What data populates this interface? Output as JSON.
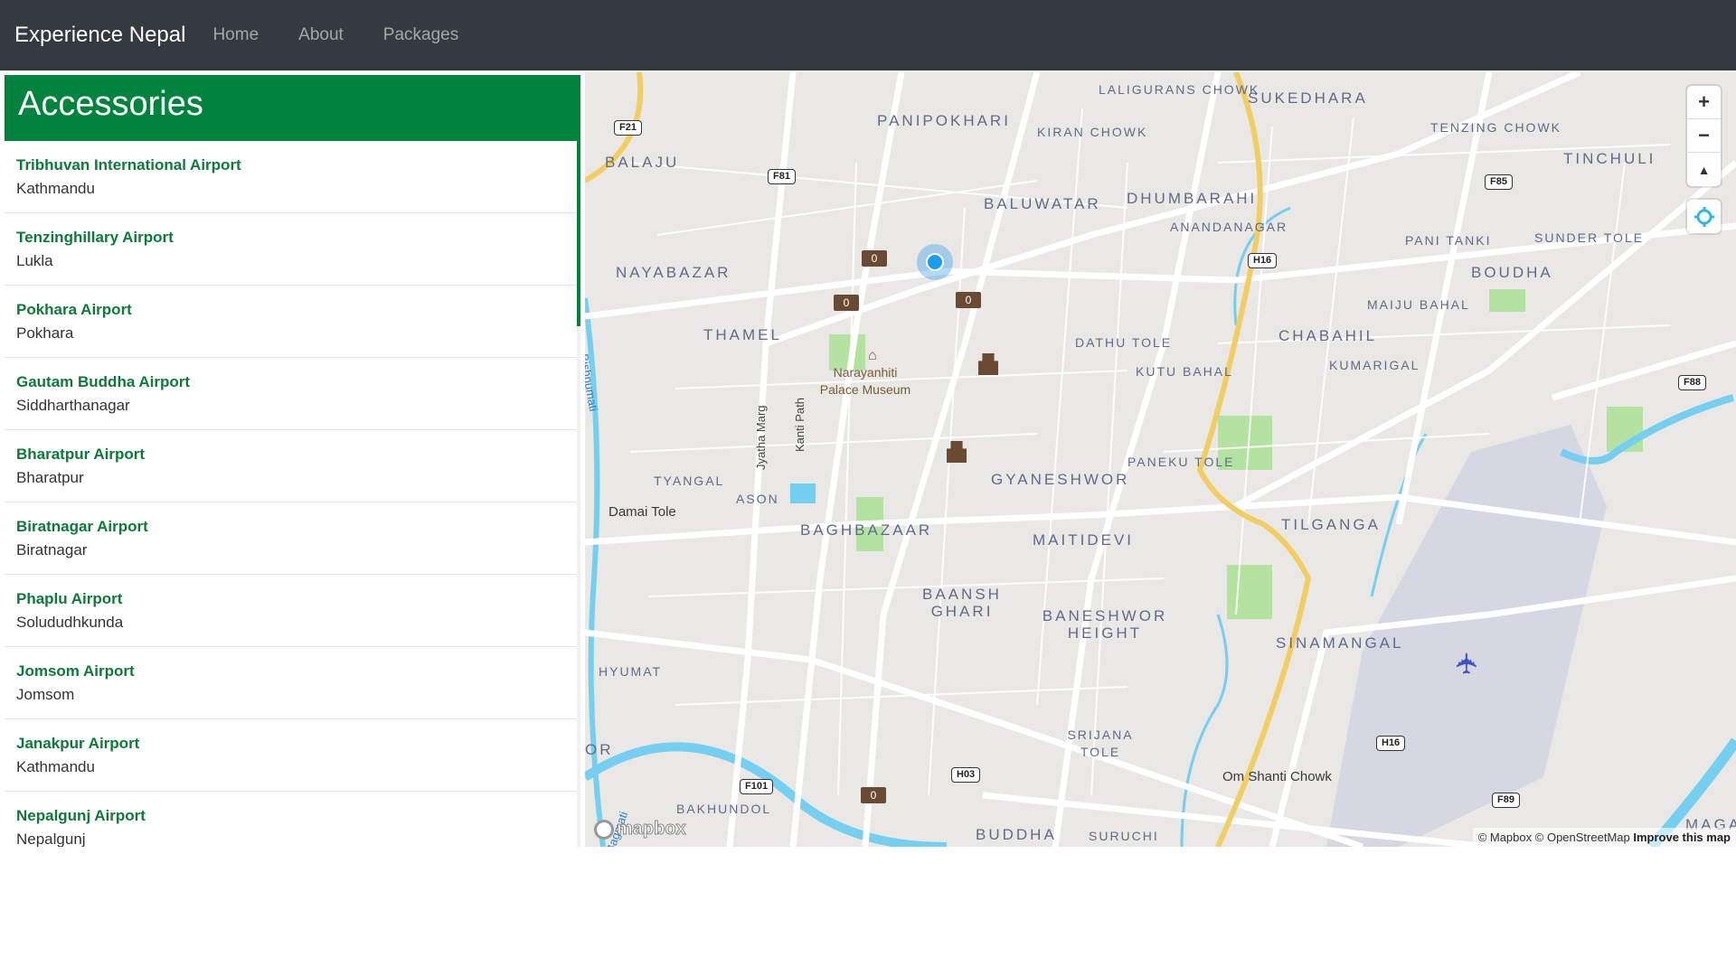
{
  "navbar": {
    "brand": "Experience Nepal",
    "links": [
      "Home",
      "About",
      "Packages"
    ]
  },
  "sidebar": {
    "title": "Accessories",
    "items": [
      {
        "name": "Tribhuvan International Airport",
        "location": "Kathmandu"
      },
      {
        "name": "Tenzinghillary Airport",
        "location": "Lukla"
      },
      {
        "name": "Pokhara Airport",
        "location": "Pokhara"
      },
      {
        "name": "Gautam Buddha Airport",
        "location": "Siddharthanagar"
      },
      {
        "name": "Bharatpur Airport",
        "location": "Bharatpur"
      },
      {
        "name": "Biratnagar Airport",
        "location": "Biratnagar"
      },
      {
        "name": "Phaplu Airport",
        "location": "Solududhkunda"
      },
      {
        "name": "Jomsom Airport",
        "location": "Jomsom"
      },
      {
        "name": "Janakpur Airport",
        "location": "Kathmandu"
      },
      {
        "name": "Nepalgunj Airport",
        "location": "Nepalgunj"
      }
    ]
  },
  "map": {
    "places": {
      "balaju": "Balaju",
      "panipokhari": "Panipokhari",
      "laligurans_chowk": "Laligurans Chowk",
      "kiran_chowk": "Kiran Chowk",
      "sukedhara": "Sukedhara",
      "tenzing_chowk": "Tenzing Chowk",
      "tinchuli": "Tinchuli",
      "baluwatar": "Baluwatar",
      "dhumbarahi": "Dhumbarahi",
      "anandanagar": "Anandanagar",
      "pani_tanki": "Pani Tanki",
      "sunder_tole": "Sunder Tole",
      "nayabazar": "Nayabazar",
      "boudha": "Boudha",
      "maiju_bahal": "Maiju Bahal",
      "thamel": "Thamel",
      "dathu_tole": "Dathu Tole",
      "chabahil": "Chabahil",
      "kutu_bahal": "Kutu Bahal",
      "kumarigal": "Kumarigal",
      "tyangal": "Tyangal",
      "ason": "Ason",
      "gyaneshwor": "Gyaneshwor",
      "paneku_tole": "Paneku Tole",
      "damai_tole": "Damai Tole",
      "baghbazaar": "Baghbazaar",
      "maitidevi": "Maitidevi",
      "tilganga": "Tilganga",
      "baansh_ghari": "Baansh Ghari",
      "baneshwor_height": "Baneshwor Height",
      "sinamangal": "Sinamangal",
      "hyumat": "Hyumat",
      "srijana_tole": "Srijana Tole",
      "om_shanti_chowk": "Om Shanti Chowk",
      "or": "Or",
      "bakhundol": "Bakhundol",
      "buddha": "Buddha",
      "suruchi": "Suruchi",
      "maga": "Maga",
      "museum": "Narayanhiti Palace Museum",
      "jyatha_marg": "Jyatha Marg",
      "kanti_path": "Kanti Path",
      "bishnumati": "Bishnumati",
      "bagmati": "Bagmati"
    },
    "shields": [
      "F21",
      "F81",
      "F85",
      "H16",
      "F88",
      "H03",
      "F101",
      "F89"
    ],
    "controls": {
      "zoom_in": "+",
      "zoom_out": "−",
      "compass": "▲"
    },
    "logo": "mapbox",
    "attribution": {
      "mapbox": "© Mapbox",
      "osm": "© OpenStreetMap",
      "improve": "Improve this map"
    },
    "colors": {
      "water": "#75cff0",
      "park": "#b4e2a0",
      "highway": "#f2cd63",
      "airport": "#d5d7e3",
      "user_location": "#1d9bf0"
    }
  },
  "colors": {
    "navbar": "#343a40",
    "accent": "#00843d"
  }
}
